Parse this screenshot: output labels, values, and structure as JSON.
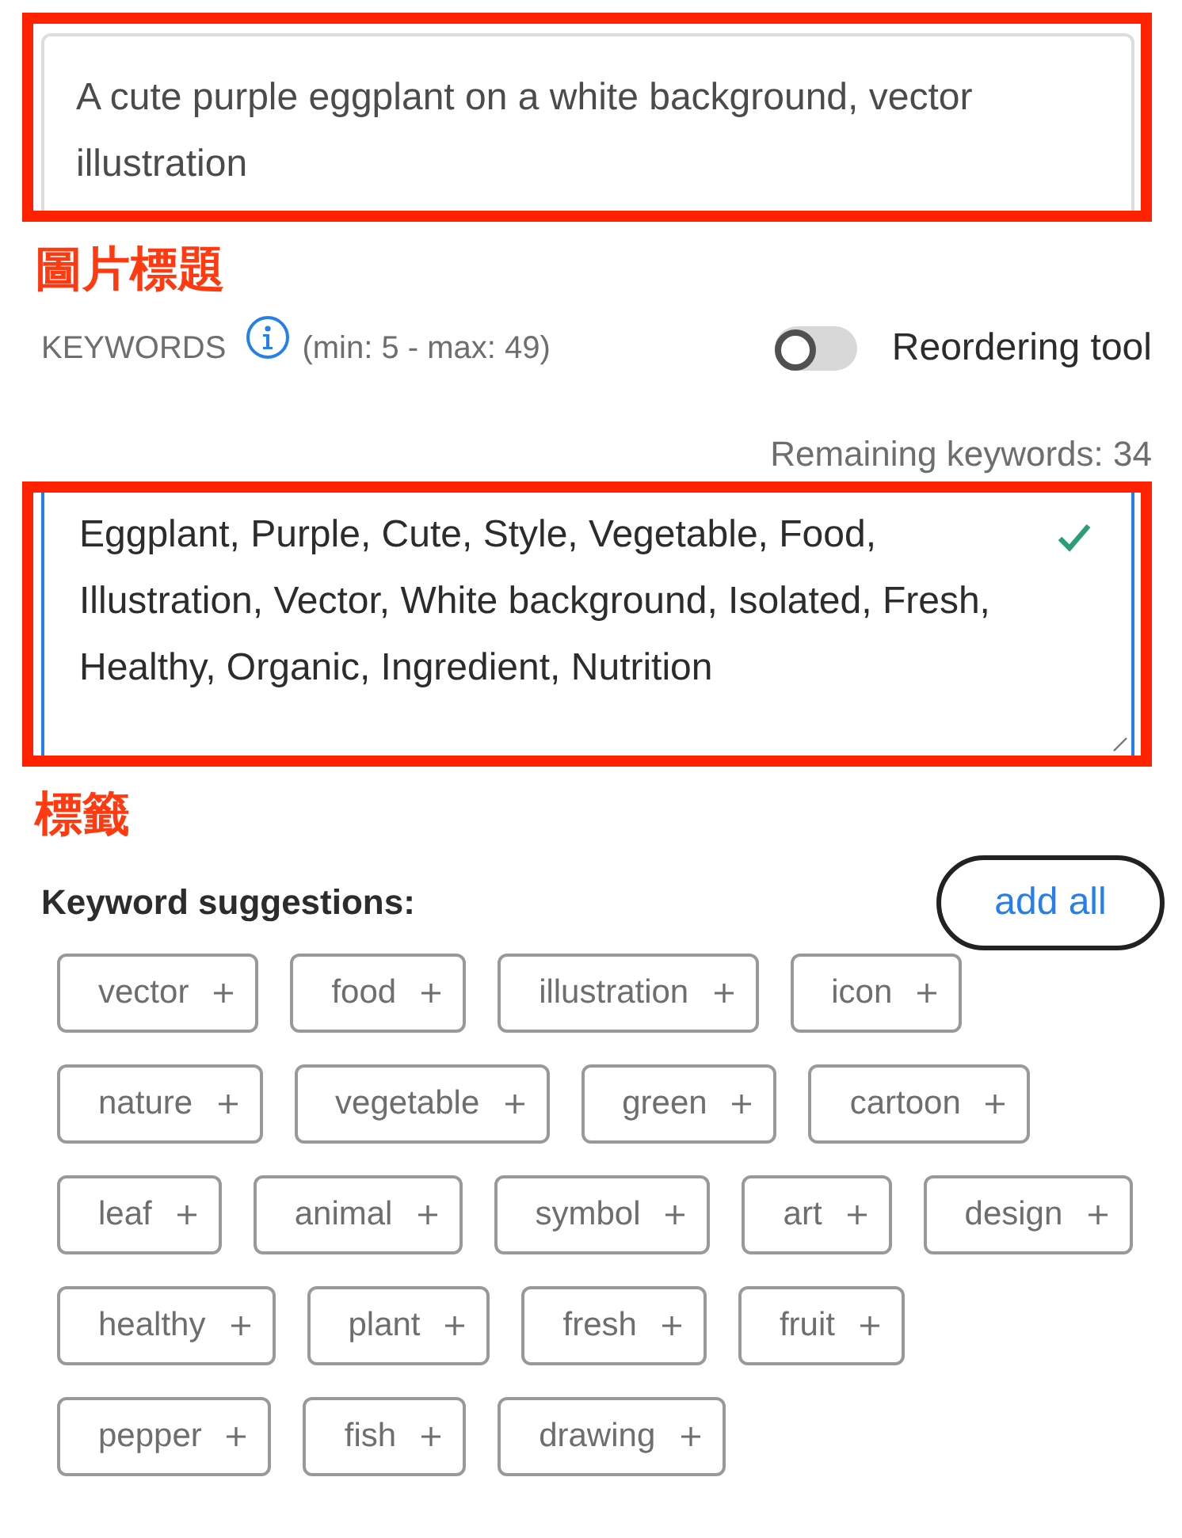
{
  "title_field": {
    "value": "A cute purple eggplant on a white background, vector illustration"
  },
  "title_annotation": "圖片標題",
  "keywords_header": {
    "label": "KEYWORDS",
    "limits": "(min: 5 - max: 49)"
  },
  "reordering_tool": {
    "label": "Reordering tool",
    "on": false
  },
  "remaining": "Remaining keywords: 34",
  "keywords_field": {
    "value": "Eggplant, Purple, Cute, Style, Vegetable, Food, Illustration, Vector, White background, Isolated, Fresh, Healthy, Organic, Ingredient, Nutrition",
    "valid": true
  },
  "keywords_annotation": "標籤",
  "suggestions": {
    "heading": "Keyword suggestions:",
    "add_all": "add all",
    "chips": [
      {
        "label": "vector"
      },
      {
        "label": "food"
      },
      {
        "label": "illustration"
      },
      {
        "label": "icon"
      },
      {
        "label": "nature"
      },
      {
        "label": "vegetable"
      },
      {
        "label": "green"
      },
      {
        "label": "cartoon"
      },
      {
        "label": "leaf"
      },
      {
        "label": "animal"
      },
      {
        "label": "symbol"
      },
      {
        "label": "art"
      },
      {
        "label": "design"
      },
      {
        "label": "healthy"
      },
      {
        "label": "plant"
      },
      {
        "label": "fresh"
      },
      {
        "label": "fruit"
      },
      {
        "label": "pepper"
      },
      {
        "label": "fish"
      },
      {
        "label": "drawing"
      }
    ]
  }
}
